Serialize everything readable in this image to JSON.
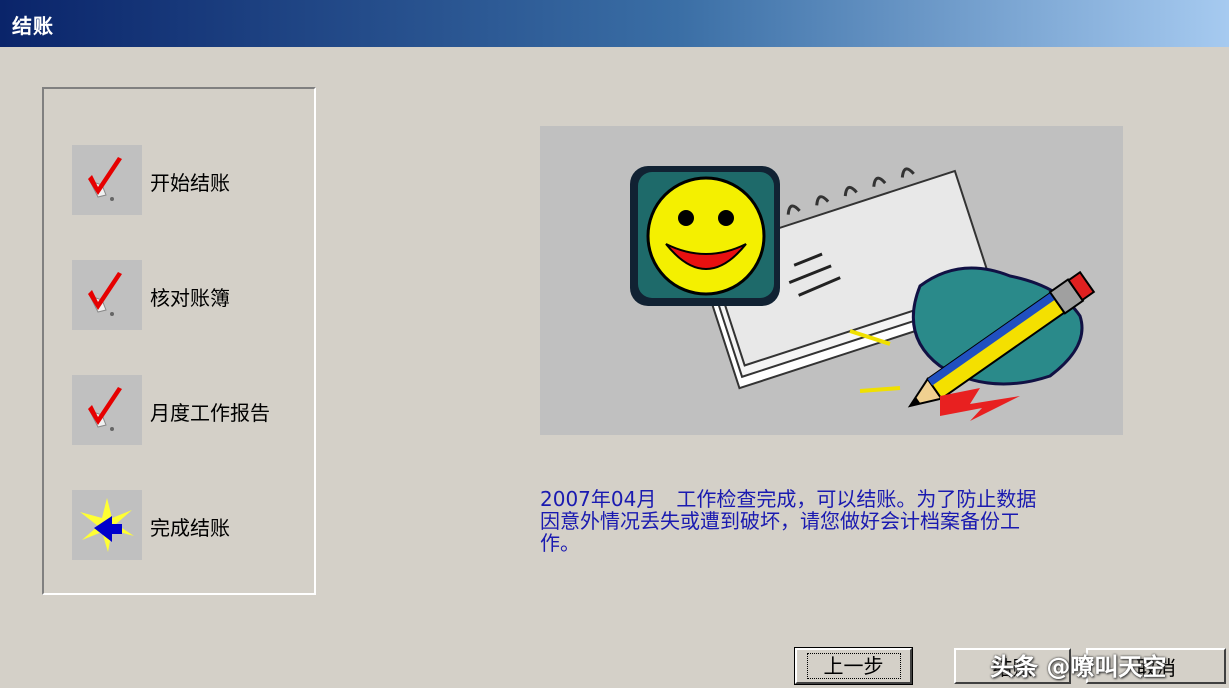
{
  "window": {
    "title": "结账"
  },
  "steps": [
    {
      "label": "开始结账",
      "icon": "red-check-icon"
    },
    {
      "label": "核对账簿",
      "icon": "red-check-icon"
    },
    {
      "label": "月度工作报告",
      "icon": "red-check-icon"
    },
    {
      "label": "完成结账",
      "icon": "sparkle-arrow-icon"
    }
  ],
  "illustration": {
    "name": "smiley-notebook-pencil-clipart"
  },
  "message": {
    "line1": "2007年04月　工作检查完成，可以结账。为了防止数据",
    "line2": "因意外情况丢失或遭到破坏，请您做好会计档案备份工",
    "line3": "作。"
  },
  "buttons": {
    "prev": "上一步",
    "finish": "结账",
    "cancel": "取消"
  },
  "watermark": "头条 @嘹叫天空"
}
